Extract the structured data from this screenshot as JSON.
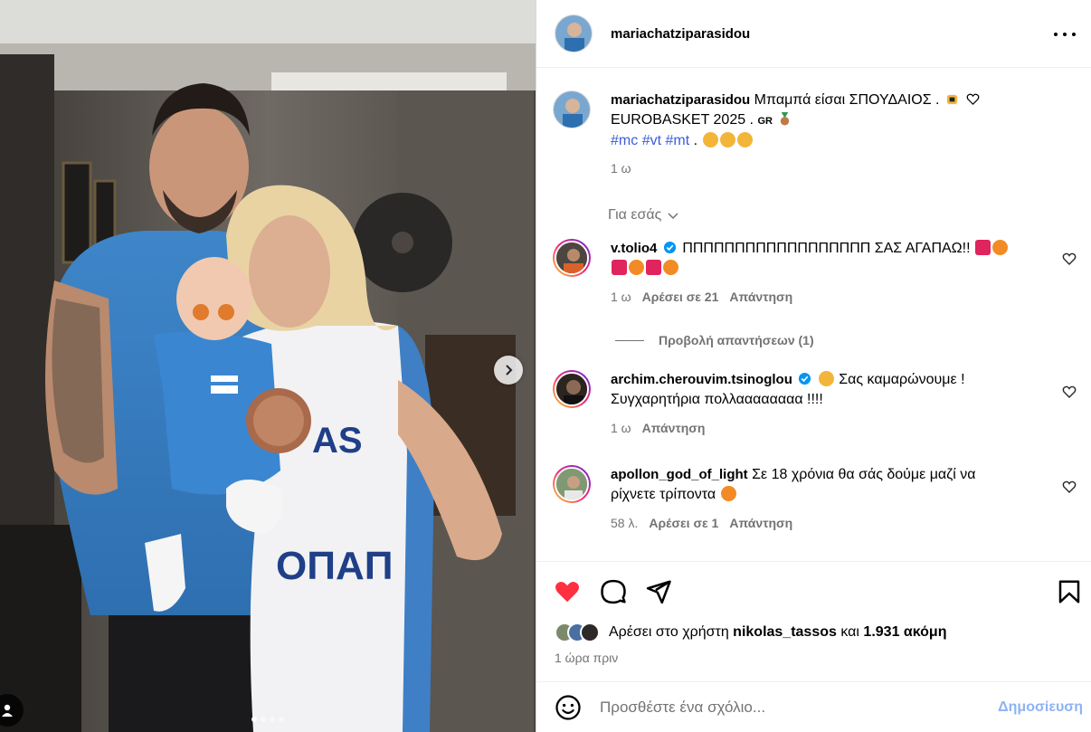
{
  "post": {
    "username": "mariachatziparasidou",
    "caption_text": "Μπαμπά είσαι ΣΠΟΥΔΑΙΟΣ .",
    "caption_line2": "EUROBASKET 2025 .",
    "caption_flag": "GR",
    "hashtags": [
      "#mc",
      "#vt",
      "#mt"
    ],
    "caption_time": "1 ω",
    "for_you": "Για εσάς",
    "photo_dots": 4,
    "photo_dot_active": 1
  },
  "comments": [
    {
      "username": "v.tolio4",
      "verified": true,
      "text": "ΠΠΠΠΠΠΠΠΠΠΠΠΠΠΠΠΠΠ ΣΑΣ ΑΓΑΠΑΩ!!",
      "time": "1 ω",
      "likes": "Αρέσει σε 21",
      "reply": "Απάντηση",
      "view_replies": "Προβολή απαντήσεων (1)"
    },
    {
      "username": "archim.cherouvim.tsinoglou",
      "verified": true,
      "text": "Σας καμαρώνουμε !",
      "text2": "Συγχαρητήρια πολλαααααααα !!!!",
      "time": "1 ω",
      "reply": "Απάντηση"
    },
    {
      "username": "apollon_god_of_light",
      "verified": false,
      "text": "Σε 18 χρόνια θα σάς δούμε μαζί να",
      "text2": "ρίχνετε τρίποντα",
      "time": "58 λ.",
      "likes": "Αρέσει σε 1",
      "reply": "Απάντηση"
    }
  ],
  "likes_line": {
    "prefix": "Αρέσει στο χρήστη",
    "user": "nikolas_tassos",
    "and": "και",
    "count": "1.931 ακόμη"
  },
  "posted_time": "1 ώρα πριν",
  "add_comment": {
    "placeholder": "Προσθέστε ένα σχόλιο...",
    "post_label": "Δημοσίευση"
  },
  "icons": {
    "like": "heart-filled-icon",
    "comment": "comment-bubble-icon",
    "share": "paper-plane-icon",
    "save": "bookmark-icon",
    "emoji": "smiley-icon",
    "more": "more-dots-icon"
  },
  "colors": {
    "like_red": "#ff3040",
    "hashtag_blue": "#3a5ddb",
    "post_button_disabled": "#8eb3f3",
    "muted_text": "#737373"
  }
}
